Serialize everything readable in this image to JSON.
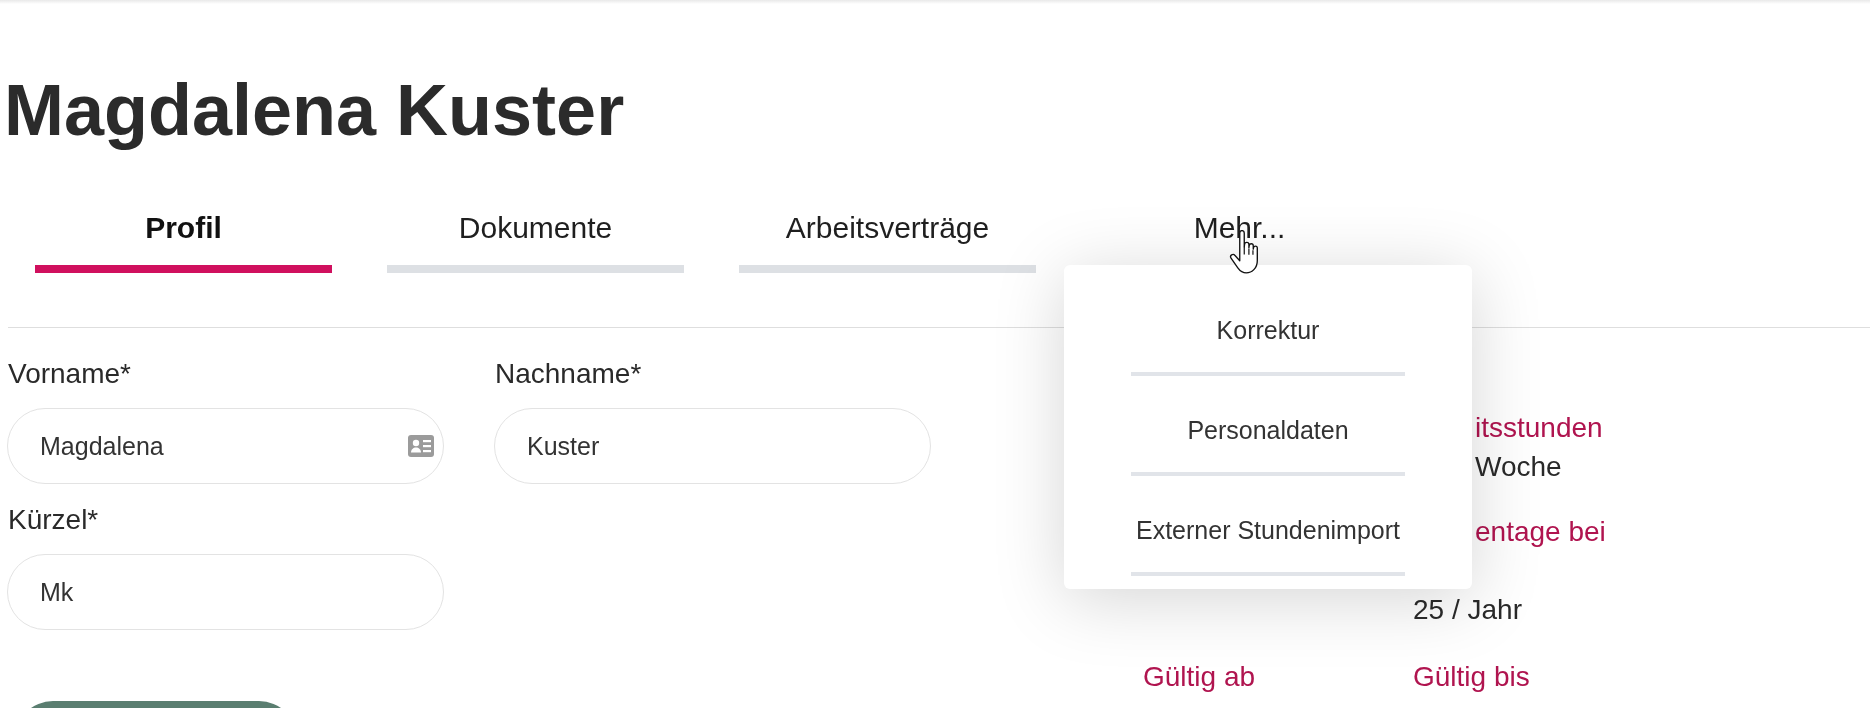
{
  "header": {
    "title": "Magdalena Kuster"
  },
  "tabs": [
    {
      "label": "Profil",
      "selected": true,
      "expanded": false
    },
    {
      "label": "Dokumente",
      "selected": false,
      "expanded": false
    },
    {
      "label": "Arbeitsverträge",
      "selected": false,
      "expanded": false
    },
    {
      "label": "Mehr...",
      "selected": false,
      "expanded": true
    }
  ],
  "more_menu": {
    "items": [
      {
        "label": "Korrektur"
      },
      {
        "label": "Personaldaten"
      },
      {
        "label": "Externer Stundenimport"
      }
    ]
  },
  "pointer": {
    "kind": "hand"
  },
  "form": {
    "fields": [
      {
        "label": "Vorname*",
        "value": "Magdalena",
        "kind": "card"
      },
      {
        "label": "Nachname*",
        "value": "Kuster",
        "kind": "plain"
      },
      {
        "label": "Kürzel*",
        "value": "Mk",
        "kind": "plain"
      }
    ],
    "actions": [
      {
        "kind": "primary"
      }
    ]
  },
  "details": {
    "groups": [
      {
        "label": {
          "text": "itsstunden",
          "covered": true
        },
        "value": {
          "text": "Woche",
          "covered": true
        }
      },
      {
        "label": {
          "text": "entage bei",
          "covered": true
        },
        "value": {
          "text": "25 / Jahr",
          "covered": false
        }
      }
    ],
    "validity": [
      {
        "label": "Gültig ab"
      },
      {
        "label": "Gültig bis"
      }
    ]
  }
}
